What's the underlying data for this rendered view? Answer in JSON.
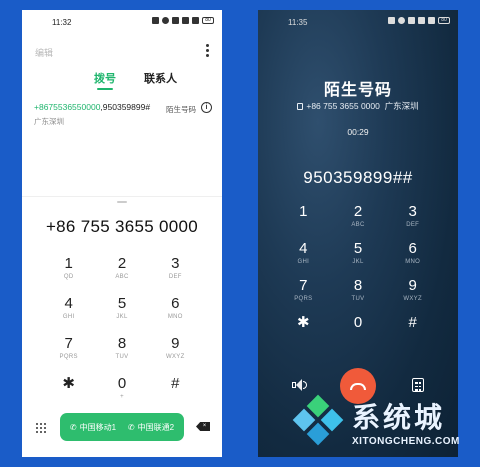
{
  "left": {
    "status_bar": {
      "time": "11:32",
      "battery": "80"
    },
    "edit_label": "编辑",
    "tabs": [
      {
        "label": "拨号",
        "active": true
      },
      {
        "label": "联系人",
        "active": false
      }
    ],
    "recent_call": {
      "number_prefix": "+8675536550000",
      "number_suffix": ",950359899#",
      "location": "广东深圳",
      "tag": "陌生号码"
    },
    "dial_display": "+86 755 3655 0000",
    "keys": [
      {
        "digit": "1",
        "letters": "QD"
      },
      {
        "digit": "2",
        "letters": "ABC"
      },
      {
        "digit": "3",
        "letters": "DEF"
      },
      {
        "digit": "4",
        "letters": "GHI"
      },
      {
        "digit": "5",
        "letters": "JKL"
      },
      {
        "digit": "6",
        "letters": "MNO"
      },
      {
        "digit": "7",
        "letters": "PQRS"
      },
      {
        "digit": "8",
        "letters": "TUV"
      },
      {
        "digit": "9",
        "letters": "WXYZ"
      },
      {
        "digit": "✱",
        "letters": ""
      },
      {
        "digit": "0",
        "letters": "+"
      },
      {
        "digit": "#",
        "letters": ""
      }
    ],
    "sim1_label": "中国移动1",
    "sim2_label": "中国联通2"
  },
  "right": {
    "status_bar": {
      "time": "11:35",
      "battery": "80"
    },
    "caller_title": "陌生号码",
    "caller_number": "+86 755 3655 0000",
    "caller_location": "广东深圳",
    "duration": "00:29",
    "dtmf": "950359899##",
    "keys": [
      {
        "digit": "1",
        "letters": ""
      },
      {
        "digit": "2",
        "letters": "ABC"
      },
      {
        "digit": "3",
        "letters": "DEF"
      },
      {
        "digit": "4",
        "letters": "GHI"
      },
      {
        "digit": "5",
        "letters": "JKL"
      },
      {
        "digit": "6",
        "letters": "MNO"
      },
      {
        "digit": "7",
        "letters": "PQRS"
      },
      {
        "digit": "8",
        "letters": "TUV"
      },
      {
        "digit": "9",
        "letters": "WXYZ"
      },
      {
        "digit": "✱",
        "letters": ""
      },
      {
        "digit": "0",
        "letters": ""
      },
      {
        "digit": "#",
        "letters": ""
      }
    ]
  },
  "watermark": {
    "title": "系统城",
    "url": "XITONGCHENG.COM"
  },
  "colors": {
    "accent_green": "#1fb56d",
    "hangup_red": "#f05a3a",
    "background_blue": "#1a5cc8"
  }
}
